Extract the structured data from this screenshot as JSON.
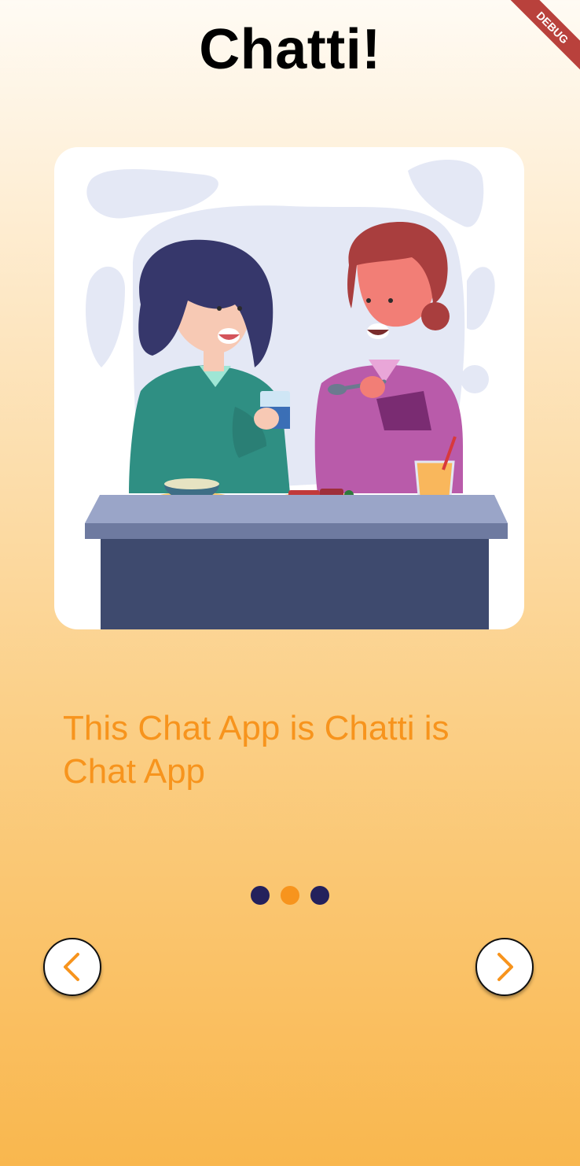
{
  "app": {
    "title": "Chatti!",
    "debug_banner": "DEBUG"
  },
  "onboarding": {
    "caption": "This Chat App is Chatti is Chat App",
    "pages_total": 3,
    "active_page": 2
  },
  "colors": {
    "accent": "#F7941D",
    "dot_inactive": "#24215C",
    "dot_active": "#F7941D"
  },
  "icons": {
    "prev": "chevron-left-icon",
    "next": "chevron-right-icon",
    "illustration": "two-women-dining-illustration"
  }
}
